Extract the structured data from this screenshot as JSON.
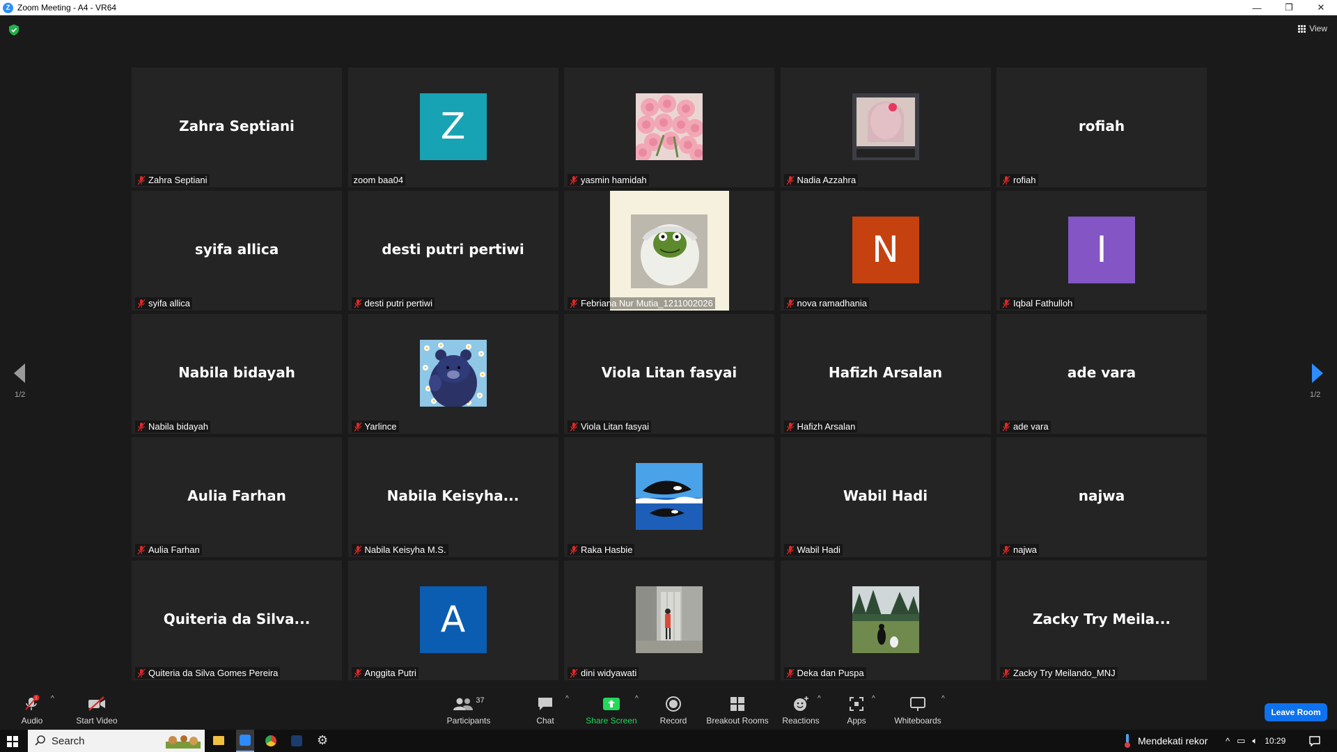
{
  "window": {
    "title": "Zoom Meeting - A4 - VR64",
    "app_icon": "Z",
    "controls": [
      "—",
      "❐",
      "✕"
    ]
  },
  "header": {
    "view_label": "View"
  },
  "tiles": [
    {
      "label": "Zahra Septiani",
      "display": "Zahra Septiani",
      "kind": "name"
    },
    {
      "label": "zoom baa04",
      "display": "Z",
      "kind": "avatar",
      "color": "#17a3b3",
      "muted": false
    },
    {
      "label": "yasmin hamidah",
      "kind": "pic",
      "pic": "roses"
    },
    {
      "label": "Nadia Azzahra",
      "kind": "pic",
      "pic": "selfie"
    },
    {
      "label": "rofiah",
      "display": "rofiah",
      "kind": "name"
    },
    {
      "label": "syifa allica",
      "display": "syifa allica",
      "kind": "name"
    },
    {
      "label": "desti putri pertiwi",
      "display": "desti putri pertiwi",
      "kind": "name"
    },
    {
      "label": "Febriana Nur Mutia_1211002026",
      "kind": "bigpic",
      "pic": "kermit"
    },
    {
      "label": "nova ramadhania",
      "display": "N",
      "kind": "avatar",
      "color": "#c5410f"
    },
    {
      "label": "Iqbal Fathulloh",
      "display": "I",
      "kind": "avatar",
      "color": "#8455c5"
    },
    {
      "label": "Nabila bidayah",
      "display": "Nabila bidayah",
      "kind": "name"
    },
    {
      "label": "Yarlince",
      "kind": "pic",
      "pic": "bear"
    },
    {
      "label": "Viola Litan fasyai",
      "display": "Viola Litan fasyai",
      "kind": "name"
    },
    {
      "label": "Hafizh Arsalan",
      "display": "Hafizh Arsalan",
      "kind": "name"
    },
    {
      "label": "ade vara",
      "display": "ade vara",
      "kind": "name"
    },
    {
      "label": "Aulia Farhan",
      "display": "Aulia Farhan",
      "kind": "name"
    },
    {
      "label": "Nabila Keisyha M.S.",
      "display": "Nabila  Keisyha...",
      "kind": "name"
    },
    {
      "label": "Raka Hasbie",
      "kind": "pic",
      "pic": "orca"
    },
    {
      "label": "Wabil Hadi",
      "display": "Wabil Hadi",
      "kind": "name"
    },
    {
      "label": "najwa",
      "display": "najwa",
      "kind": "name"
    },
    {
      "label": "Quiteria da Silva Gomes Pereira",
      "display": "Quiteria  da Silva...",
      "kind": "name"
    },
    {
      "label": "Anggita Putri",
      "display": "A",
      "kind": "avatar",
      "color": "#0a5db1"
    },
    {
      "label": "dini widyawati",
      "kind": "pic",
      "pic": "building"
    },
    {
      "label": "Deka dan Puspa",
      "kind": "pic",
      "pic": "park"
    },
    {
      "label": "Zacky Try Meilando_MNJ",
      "display": "Zacky  Try  Meila...",
      "kind": "name"
    }
  ],
  "paging": {
    "left": "1/2",
    "right": "1/2"
  },
  "toolbar": {
    "audio": "Audio",
    "start_video": "Start Video",
    "participants": "Participants",
    "participants_count": "37",
    "chat": "Chat",
    "share_screen": "Share Screen",
    "record": "Record",
    "breakout_rooms": "Breakout Rooms",
    "reactions": "Reactions",
    "apps": "Apps",
    "whiteboards": "Whiteboards",
    "leave_room": "Leave Room"
  },
  "taskbar": {
    "search_label": "Search",
    "weather_text": "Mendekati rekor",
    "time": "10:29"
  },
  "colors": {
    "accent": "#2d8cff",
    "share_green": "#23d959",
    "mute_red": "#e02828",
    "tile_bg": "#242424"
  }
}
